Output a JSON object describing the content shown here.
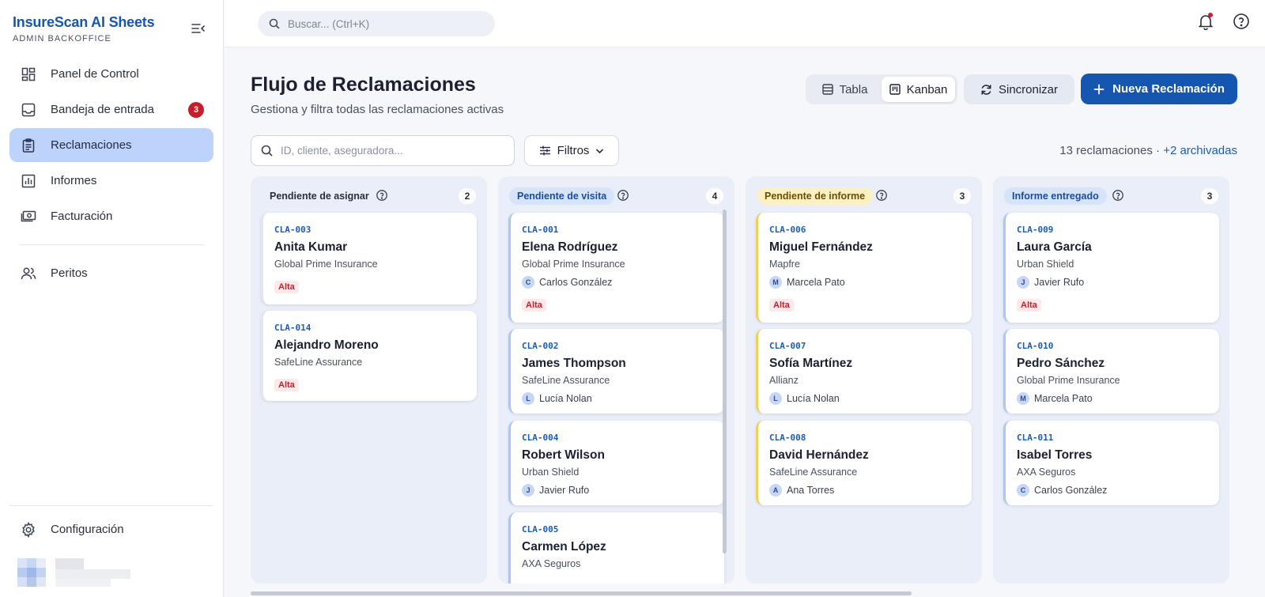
{
  "brand": {
    "title": "InsureScan AI Sheets",
    "subtitle": "ADMIN BACKOFFICE"
  },
  "sidebar": {
    "items": [
      {
        "label": "Panel de Control",
        "icon": "dashboard-icon"
      },
      {
        "label": "Bandeja de entrada",
        "icon": "inbox-icon",
        "badge": "3"
      },
      {
        "label": "Reclamaciones",
        "icon": "clipboard-icon",
        "active": true
      },
      {
        "label": "Informes",
        "icon": "bar-chart-icon"
      },
      {
        "label": "Facturación",
        "icon": "banknote-icon"
      },
      {
        "label": "Peritos",
        "icon": "users-icon"
      }
    ],
    "settings_label": "Configuración"
  },
  "topbar": {
    "search_placeholder": "Buscar... (Ctrl+K)"
  },
  "page": {
    "title": "Flujo de Reclamaciones",
    "subtitle": "Gestiona y filtra todas las reclamaciones activas"
  },
  "toolbar": {
    "view_table": "Tabla",
    "view_kanban": "Kanban",
    "sync_label": "Sincronizar",
    "new_label": "Nueva Reclamación",
    "filter_placeholder": "ID, cliente, aseguradora...",
    "filters_label": "Filtros",
    "count_text": "13 reclamaciones ·",
    "archived_link": "+2 archivadas"
  },
  "colors": {
    "accent": "#1557b0",
    "priority_high": "#c81e2b",
    "col_blue_label_bg": "#d6e4fb",
    "col_yellow_label_bg": "#fdf1c4",
    "col_yellow_border": "#f0cf5a",
    "col_blue_border": "#a8c8f4"
  },
  "board": {
    "columns": [
      {
        "label": "Pendiente de asignar",
        "count": "2",
        "cards": [
          {
            "id": "CLA-003",
            "name": "Anita Kumar",
            "insurer": "Global Prime Insurance",
            "priority": "Alta"
          },
          {
            "id": "CLA-014",
            "name": "Alejandro Moreno",
            "insurer": "SafeLine Assurance",
            "priority": "Alta"
          }
        ]
      },
      {
        "label": "Pendiente de visita",
        "count": "4",
        "cards": [
          {
            "id": "CLA-001",
            "name": "Elena Rodríguez",
            "insurer": "Global Prime Insurance",
            "initial": "C",
            "expert": "Carlos González",
            "priority": "Alta"
          },
          {
            "id": "CLA-002",
            "name": "James Thompson",
            "insurer": "SafeLine Assurance",
            "initial": "L",
            "expert": "Lucía Nolan"
          },
          {
            "id": "CLA-004",
            "name": "Robert Wilson",
            "insurer": "Urban Shield",
            "initial": "J",
            "expert": "Javier Rufo"
          },
          {
            "id": "CLA-005",
            "name": "Carmen López",
            "insurer": "AXA Seguros"
          }
        ]
      },
      {
        "label": "Pendiente de informe",
        "count": "3",
        "cards": [
          {
            "id": "CLA-006",
            "name": "Miguel Fernández",
            "insurer": "Mapfre",
            "initial": "M",
            "expert": "Marcela Pato",
            "priority": "Alta"
          },
          {
            "id": "CLA-007",
            "name": "Sofía Martínez",
            "insurer": "Allianz",
            "initial": "L",
            "expert": "Lucía Nolan"
          },
          {
            "id": "CLA-008",
            "name": "David Hernández",
            "insurer": "SafeLine Assurance",
            "initial": "A",
            "expert": "Ana Torres"
          }
        ]
      },
      {
        "label": "Informe entregado",
        "count": "3",
        "cards": [
          {
            "id": "CLA-009",
            "name": "Laura García",
            "insurer": "Urban Shield",
            "initial": "J",
            "expert": "Javier Rufo",
            "priority": "Alta"
          },
          {
            "id": "CLA-010",
            "name": "Pedro Sánchez",
            "insurer": "Global Prime Insurance",
            "initial": "M",
            "expert": "Marcela Pato"
          },
          {
            "id": "CLA-011",
            "name": "Isabel Torres",
            "insurer": "AXA Seguros",
            "initial": "C",
            "expert": "Carlos González"
          }
        ]
      }
    ]
  }
}
